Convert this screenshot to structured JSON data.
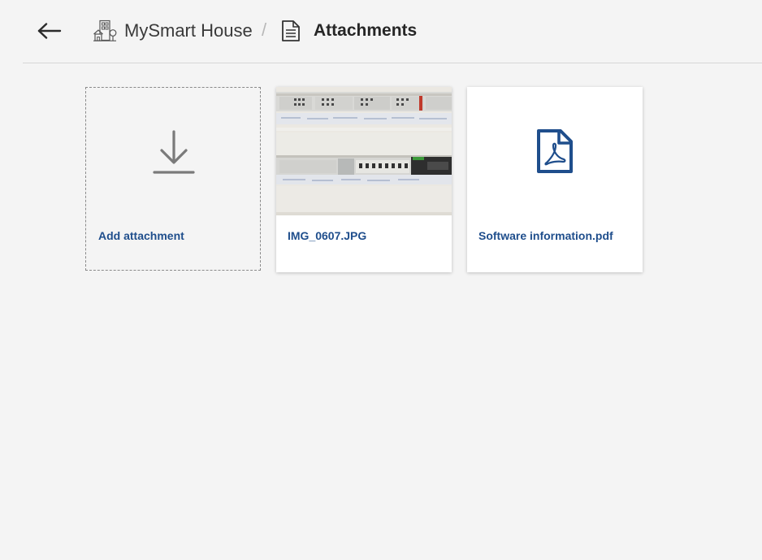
{
  "header": {
    "back_icon": "arrow-left-icon",
    "home_icon": "house-icon",
    "home_label": "MySmart House",
    "separator": "/",
    "current_icon": "document-icon",
    "current_label": "Attachments"
  },
  "attachments": {
    "add": {
      "icon": "download-arrow-icon",
      "label": "Add attachment"
    },
    "items": [
      {
        "type": "image",
        "icon": "image-thumbnail",
        "label": "IMG_0607.JPG"
      },
      {
        "type": "pdf",
        "icon": "pdf-file-icon",
        "label": "Software information.pdf"
      }
    ]
  },
  "colors": {
    "accent": "#1f4e8c",
    "background": "#f4f4f4",
    "card": "#ffffff"
  }
}
